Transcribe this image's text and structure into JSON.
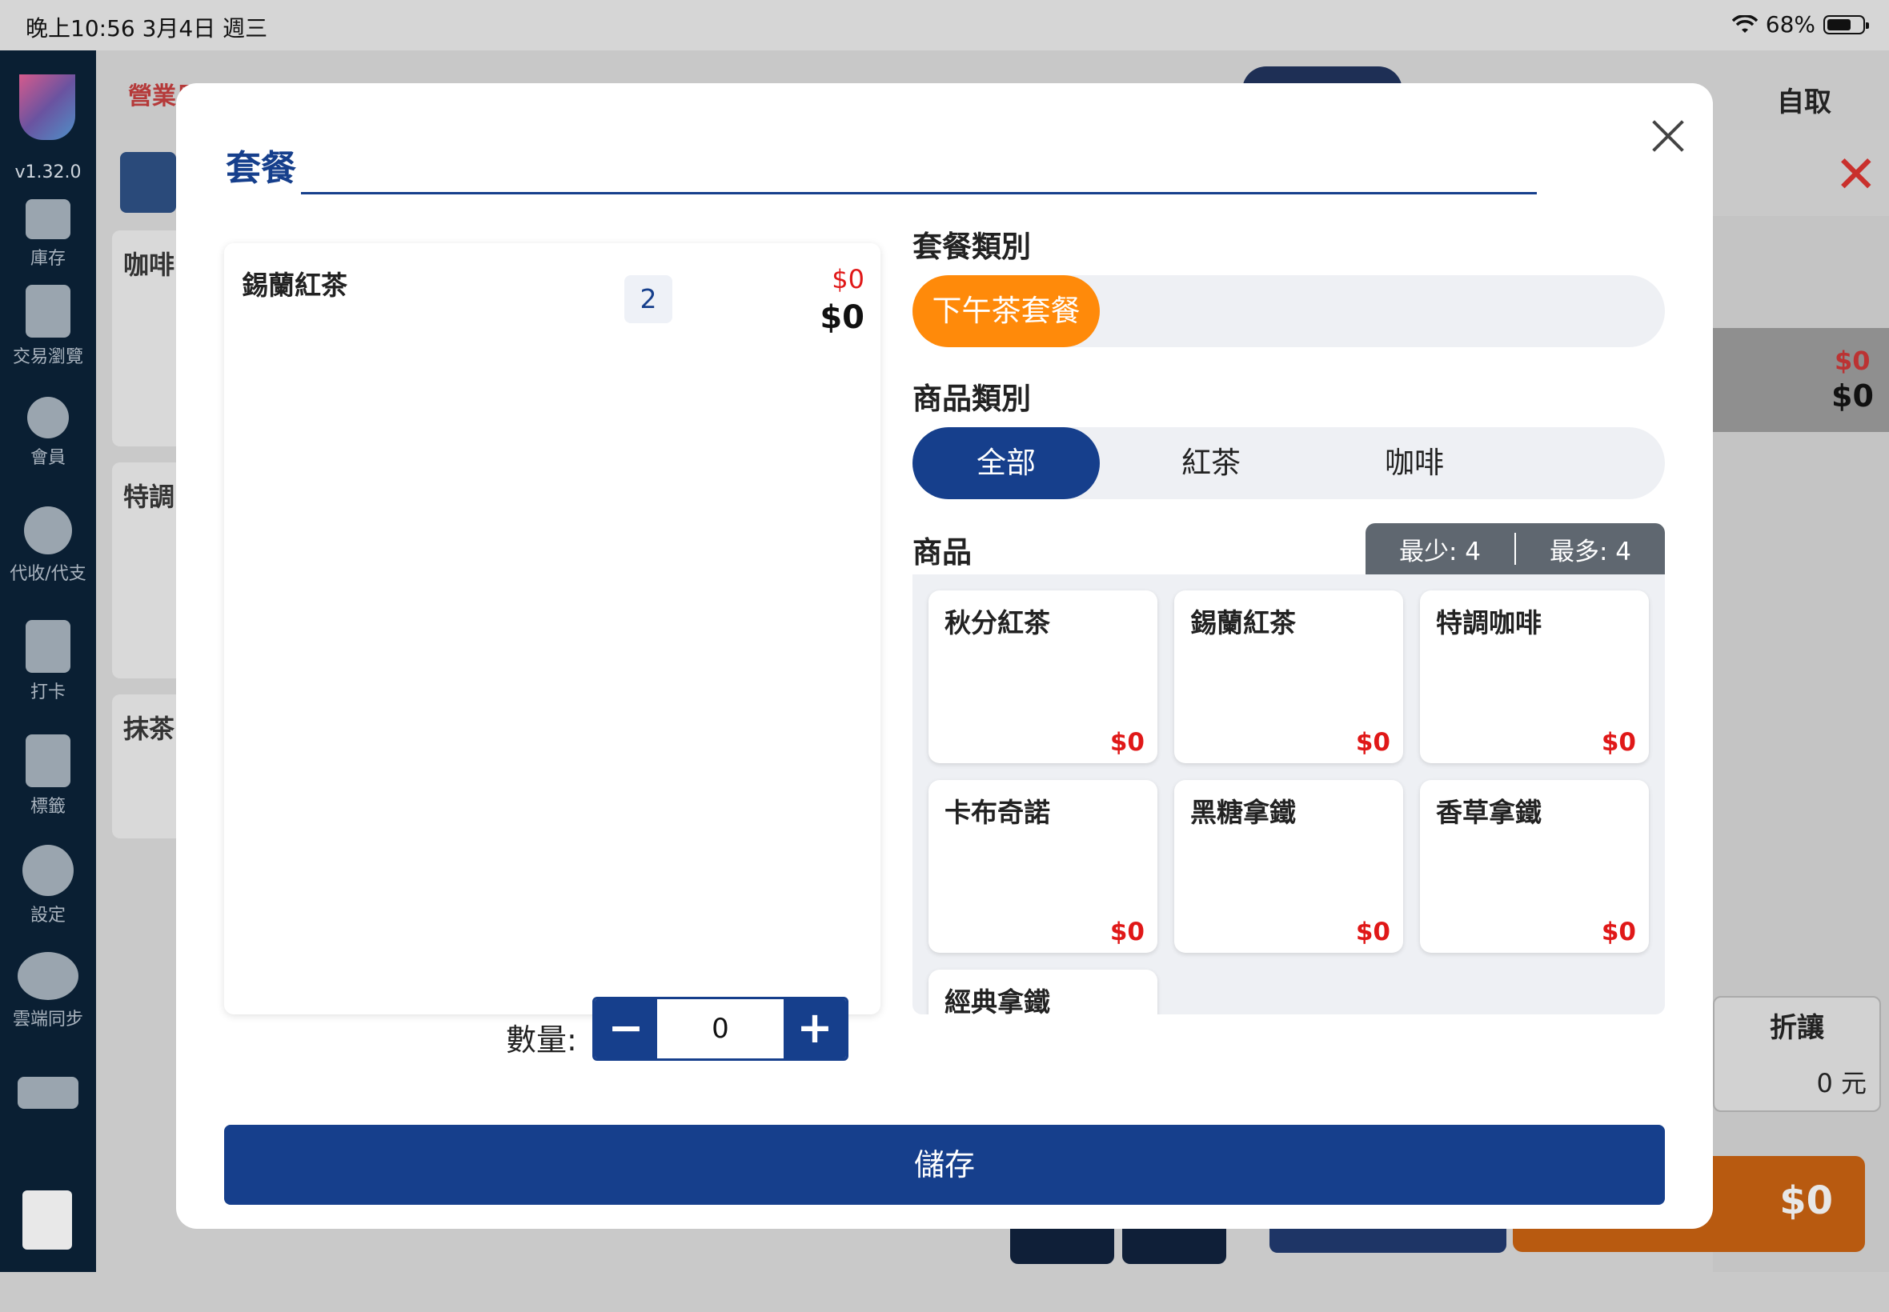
{
  "status_bar": {
    "time_date": "晚上10:56   3月4日 週三",
    "wifi_battery": "68%",
    "battery_percent": 68
  },
  "sidebar": {
    "version": "v1.32.0",
    "items": [
      {
        "label": "庫存",
        "icon": "book-icon"
      },
      {
        "label": "交易瀏覽",
        "icon": "receipt-icon"
      },
      {
        "label": "會員",
        "icon": "user-icon"
      },
      {
        "label": "代收/代支",
        "icon": "dollar-cycle-icon"
      },
      {
        "label": "打卡",
        "icon": "clock-in-icon"
      },
      {
        "label": "標籤",
        "icon": "tag-icon"
      },
      {
        "label": "設定",
        "icon": "gear-icon"
      },
      {
        "label": "雲端同步",
        "icon": "cloud-sync-icon"
      }
    ]
  },
  "background": {
    "date_label": "營業日期",
    "pickup": "自取",
    "categories": [
      "咖啡",
      "特調",
      "抹茶"
    ],
    "right_price_red": "$0",
    "right_price": "$0",
    "discount_label": "折讓",
    "discount_value": "0 元",
    "pay_total": "$0"
  },
  "modal": {
    "title": "套餐",
    "selected_item": {
      "name": "錫蘭紅茶",
      "qty": "2",
      "price_red": "$0",
      "price": "$0"
    },
    "quantity_label": "數量:",
    "quantity_value": "0",
    "combo_category_label": "套餐類別",
    "combo_categories": [
      "下午茶套餐"
    ],
    "product_category_label": "商品類別",
    "product_categories": [
      "全部",
      "紅茶",
      "咖啡"
    ],
    "products_label": "商品",
    "min_label": "最少: 4",
    "max_label": "最多: 4",
    "products": [
      {
        "name": "秋分紅茶",
        "price": "$0"
      },
      {
        "name": "錫蘭紅茶",
        "price": "$0"
      },
      {
        "name": "特調咖啡",
        "price": "$0"
      },
      {
        "name": "卡布奇諾",
        "price": "$0"
      },
      {
        "name": "黑糖拿鐵",
        "price": "$0"
      },
      {
        "name": "香草拿鐵",
        "price": "$0"
      },
      {
        "name": "經典拿鐵",
        "price": ""
      }
    ],
    "save_label": "儲存"
  },
  "colors": {
    "primary": "#163f8c",
    "accent_orange": "#ff8a0a",
    "price_red": "#e01818"
  }
}
